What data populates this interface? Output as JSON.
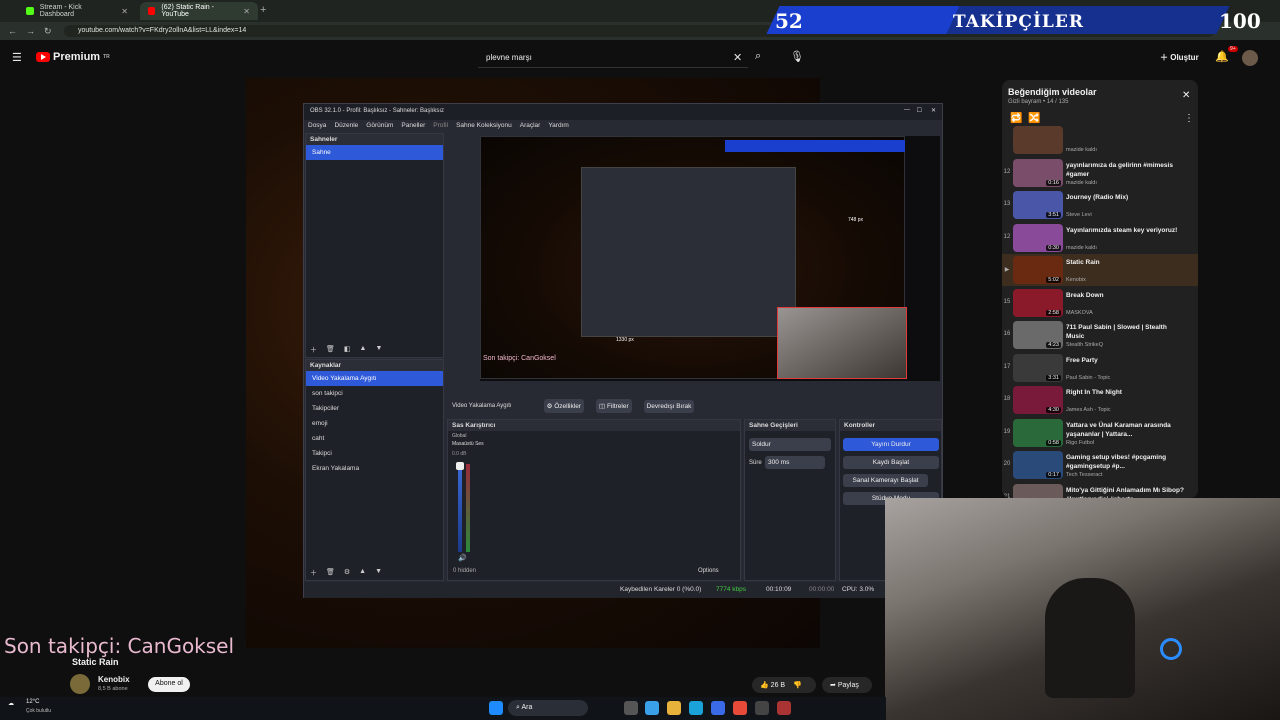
{
  "browser": {
    "tabs": [
      {
        "label": "Stream - Kick Dashboard",
        "color": "#53fc18"
      },
      {
        "label": "(62) Static Rain - YouTube",
        "color": "#ff0000"
      }
    ],
    "url": "youtube.com/watch?v=FKdry2ollnA&list=LL&index=14"
  },
  "banner": {
    "left_count": "52",
    "title": "TAKİPÇİLER",
    "right_count": "100"
  },
  "youtube": {
    "logo_label": "Premium",
    "region": "TR",
    "search_value": "plevne marşı",
    "create_label": "Oluştur",
    "notif_badge": "9+"
  },
  "obs": {
    "title": "OBS 32.1.0 - Profil: Başlıksız - Sahneler: Başlıksız",
    "menu": [
      "Dosya",
      "Düzenle",
      "Görünüm",
      "Paneller",
      "Profil",
      "Sahne Koleksiyonu",
      "Araçlar",
      "Yardım"
    ],
    "scenes_title": "Sahneler",
    "scenes": [
      "Sahne"
    ],
    "sources_title": "Kaynaklar",
    "sources": [
      "Video Yakalama Aygıtı",
      "son takipci",
      "Takipciler",
      "emoji",
      "caht",
      "Takipci",
      "Ekran Yakalama"
    ],
    "source_bar": {
      "name": "Video Yakalama Aygıtı",
      "props": "Özellikler",
      "filters": "Filtreler",
      "deactivate": "Devredışı Bırak"
    },
    "mixer_title": "Sas Karıştırıcı",
    "mixer_channel": "Masaüstü Ses",
    "mixer_tag": "Global",
    "mixer_db": "0.0 dB",
    "mixer_hidden": "0 hidden",
    "mixer_options": "Options",
    "transitions_title": "Sahne Geçişleri",
    "transition_value": "Soldur",
    "duration_label": "Süre",
    "duration_value": "300 ms",
    "controls_title": "Kontroller",
    "controls": [
      "Yayını Durdur",
      "Kaydı Başlat",
      "Sanal Kamerayı Başlat",
      "Stüdyo Modu"
    ],
    "status": {
      "dropped": "Kaybedilen Kareler 0 (%0.0)",
      "bitrate": "7774 kbps",
      "stream_time": "00:10:09",
      "rec_time": "00:00:00",
      "cpu": "CPU: 3.0%"
    },
    "preview_follower": "Son takipçi: CanGoksel",
    "preview_measure": "1330 px",
    "preview_measure2": "748 px"
  },
  "playlist": {
    "title": "Beğendiğim videolar",
    "subtitle": "Gizli bayram • 14 / 135",
    "items": [
      {
        "idx": "",
        "title": "",
        "channel": "mazide kaldı",
        "dur": "",
        "color": "#5a3a2a"
      },
      {
        "idx": "12",
        "title": "yayınlarımıza da gelirinn #mimesis #gamer",
        "channel": "mazide kaldı",
        "dur": "0:16",
        "color": "#7a4d6a"
      },
      {
        "idx": "13",
        "title": "Journey (Radio Mix)",
        "channel": "Steve Levi",
        "dur": "3:51",
        "color": "#4a57a8"
      },
      {
        "idx": "12",
        "title": "Yayınlarımızda steam key veriyoruz!",
        "channel": "mazide kaldı",
        "dur": "0:30",
        "color": "#8a4a9a"
      },
      {
        "idx": "▶",
        "title": "Static Rain",
        "channel": "Kenobix",
        "dur": "5:02",
        "color": "#6a2a12"
      },
      {
        "idx": "15",
        "title": "Break Down",
        "channel": "MASKOVA",
        "dur": "2:58",
        "color": "#8a1a2a"
      },
      {
        "idx": "16",
        "title": "711 Paul Sabin | Slowed | Stealth Music",
        "channel": "Stealth StrikeQ",
        "dur": "4:23",
        "color": "#6a6a6a"
      },
      {
        "idx": "17",
        "title": "Free Party",
        "channel": "Paul Sabin - Topic",
        "dur": "3:31",
        "color": "#3a3a3a"
      },
      {
        "idx": "18",
        "title": "Right In The Night",
        "channel": "James Ash - Topic",
        "dur": "4:30",
        "color": "#7a1a3a"
      },
      {
        "idx": "19",
        "title": "Yattara ve Ünal Karaman arasında yaşananlar | Yattara...",
        "channel": "Rigo Futbol",
        "dur": "0:58",
        "color": "#2a6a3a"
      },
      {
        "idx": "20",
        "title": "Gaming setup vibes! #pcgaming #gamingsetup #p...",
        "channel": "Tech Tesseract",
        "dur": "0:17",
        "color": "#2a4a7a"
      },
      {
        "idx": "21",
        "title": "Mito'ya Gittiğini Anlamadım Mı Sibop? #kurtlarvadisi #shorts",
        "channel": "",
        "dur": "1:03",
        "color": "#6a5a5a"
      }
    ]
  },
  "overlay": {
    "last_follower": "Son takipçi: CanGoksel"
  },
  "video": {
    "title": "Static Rain",
    "channel_name": "Kenobix",
    "subscribers": "8,5 B abone",
    "subscribe": "Abone ol",
    "likes": "26 B",
    "share": "Paylaş"
  },
  "taskbar": {
    "weather_temp": "12°C",
    "weather_desc": "Çok bulutlu",
    "search": "Ara"
  }
}
